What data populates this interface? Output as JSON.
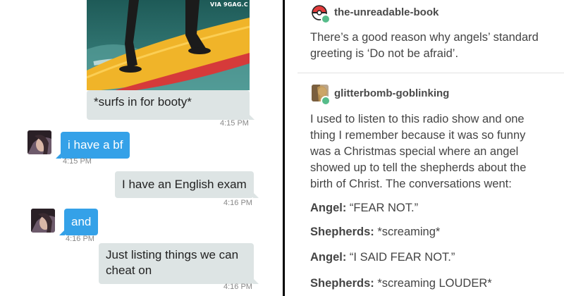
{
  "chat": {
    "watermark": "VIA 9GAG.C",
    "messages": [
      {
        "text": "*surfs in for booty*",
        "time": "4:15 PM"
      },
      {
        "text": "i have a bf",
        "time": "4:15 PM"
      },
      {
        "text": "I have an English exam",
        "time": "4:16 PM"
      },
      {
        "text": "and",
        "time": "4:16 PM"
      },
      {
        "text_line1": "Just listing things we can",
        "text_line2": "cheat on",
        "time": "4:16 PM"
      }
    ],
    "colors": {
      "incoming": "#34a1e8",
      "outgoing": "#dde4e4"
    }
  },
  "tumblr": {
    "post1": {
      "username": "the-unreadable-book",
      "line1": "There’s a good reason why angels’ standard",
      "line2": "greeting is ‘Do not be afraid’."
    },
    "post2": {
      "username": "glitterbomb-goblinking",
      "lines": [
        "I used to listen to this radio show and one",
        "thing I remember because it was so funny",
        "was a Christmas special where an angel",
        "showed up to tell the shepherds about the",
        "birth of Christ.  The conversations went:"
      ],
      "dialogue": [
        {
          "speaker": "Angel:",
          "text": " “FEAR NOT.”"
        },
        {
          "speaker": "Shepherds:",
          "text": " *screaming*"
        },
        {
          "speaker": "Angel:",
          "text": " “I SAID FEAR NOT.”"
        },
        {
          "speaker": "Shepherds:",
          "text": " *screaming LOUDER*"
        }
      ]
    }
  }
}
